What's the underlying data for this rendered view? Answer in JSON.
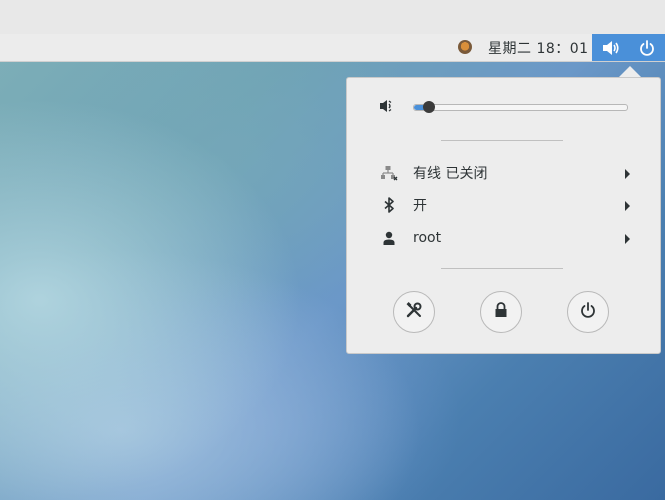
{
  "panel": {
    "clock": "星期二 18：01",
    "tray_icons": [
      "volume-icon",
      "power-icon"
    ]
  },
  "menu": {
    "volume": {
      "icon": "volume-low-icon",
      "level_fraction": 0.07
    },
    "items": [
      {
        "icon": "wired-network-disconnected-icon",
        "label": "有线 已关闭"
      },
      {
        "icon": "bluetooth-icon",
        "label": "开"
      },
      {
        "icon": "user-icon",
        "label": "root"
      }
    ],
    "buttons": [
      "settings-icon",
      "lock-icon",
      "power-icon"
    ]
  },
  "colors": {
    "accent": "#4a90d9",
    "menu_bg": "#ededed",
    "text": "#2e3436"
  }
}
